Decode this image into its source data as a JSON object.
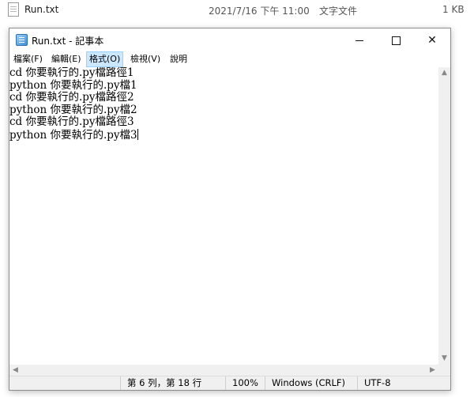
{
  "explorer": {
    "file_name": "Run.txt",
    "modified": "2021/7/16 下午 11:00",
    "type": "文字文件",
    "size": "1 KB"
  },
  "window": {
    "title": "Run.txt - 記事本",
    "minimize_glyph": "─",
    "close_glyph": "✕"
  },
  "menu": {
    "file": "檔案(F)",
    "edit": "編輯(E)",
    "format": "格式(O)",
    "view": "檢視(V)",
    "help": "說明"
  },
  "editor": {
    "lines": [
      "cd 你要執行的.py檔路徑1",
      "python 你要執行的.py檔1",
      "cd 你要執行的.py檔路徑2",
      "python 你要執行的.py檔2",
      "cd 你要執行的.py檔路徑3",
      "python 你要執行的.py檔3"
    ]
  },
  "scrollbars": {
    "up": "▲",
    "down": "▼",
    "left": "◀",
    "right": "▶"
  },
  "status": {
    "position": "第 6 列，第 18 行",
    "zoom": "100%",
    "line_ending": "Windows (CRLF)",
    "encoding": "UTF-8"
  },
  "colors": {
    "menu_active_bg": "#cce8ff",
    "statusbar_bg": "#f0f0f0"
  }
}
